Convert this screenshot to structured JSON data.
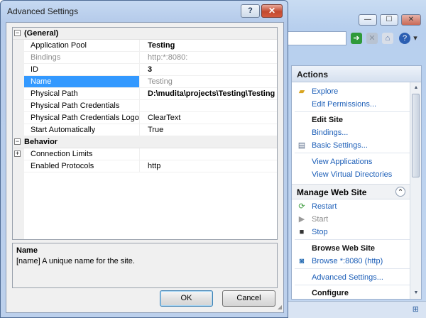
{
  "dialog": {
    "title": "Advanced Settings",
    "help_label": "?",
    "close_label": "✕",
    "grid": {
      "categories": [
        {
          "label": "(General)",
          "expander": "−",
          "properties": [
            {
              "name": "Application Pool",
              "value": "Testing",
              "style": "bold"
            },
            {
              "name": "Bindings",
              "value": "http:*:8080:",
              "style": "gray"
            },
            {
              "name": "ID",
              "value": "3",
              "style": "bold"
            },
            {
              "name": "Name",
              "value": "Testing",
              "style": "gray",
              "selected": true
            },
            {
              "name": "Physical Path",
              "value": "D:\\mudita\\projects\\Testing\\Testing",
              "style": "bold"
            },
            {
              "name": "Physical Path Credentials",
              "value": "",
              "style": "normal"
            },
            {
              "name": "Physical Path Credentials Logon Type",
              "value": "ClearText",
              "style": "normal"
            },
            {
              "name": "Start Automatically",
              "value": "True",
              "style": "normal"
            }
          ]
        },
        {
          "label": "Behavior",
          "expander": "−",
          "properties": [
            {
              "name": "Connection Limits",
              "value": "",
              "style": "normal",
              "expander": "+"
            },
            {
              "name": "Enabled Protocols",
              "value": "http",
              "style": "normal"
            }
          ]
        }
      ]
    },
    "description": {
      "title": "Name",
      "text": "[name] A unique name for the site."
    },
    "ok_label": "OK",
    "cancel_label": "Cancel"
  },
  "iis_window": {
    "caption_buttons": [
      "—",
      "☐",
      "✕"
    ],
    "actions": {
      "header": "Actions",
      "items": [
        {
          "label": "Explore",
          "kind": "link",
          "icon": "folder-icon"
        },
        {
          "label": "Edit Permissions...",
          "kind": "link"
        },
        {
          "label": "Edit Site",
          "kind": "heading"
        },
        {
          "label": "Bindings...",
          "kind": "link"
        },
        {
          "label": "Basic Settings...",
          "kind": "link",
          "icon": "settings-icon"
        },
        {
          "label": "View Applications",
          "kind": "link"
        },
        {
          "label": "View Virtual Directories",
          "kind": "link"
        }
      ],
      "manage_group": {
        "title": "Manage Web Site",
        "collapse": "⌃",
        "items": [
          {
            "label": "Restart",
            "kind": "link",
            "icon": "restart-icon"
          },
          {
            "label": "Start",
            "kind": "disabled",
            "icon": "play-icon"
          },
          {
            "label": "Stop",
            "kind": "link",
            "icon": "stop-icon"
          },
          {
            "label": "Browse Web Site",
            "kind": "heading"
          },
          {
            "label": "Browse *:8080 (http)",
            "kind": "link",
            "icon": "browse-icon"
          },
          {
            "label": "Advanced Settings...",
            "kind": "link"
          },
          {
            "label": "Configure",
            "kind": "heading"
          }
        ]
      }
    }
  },
  "colors": {
    "selection": "#3399ff",
    "link": "#1d5fb8",
    "title_bar": "#b5cbea"
  }
}
